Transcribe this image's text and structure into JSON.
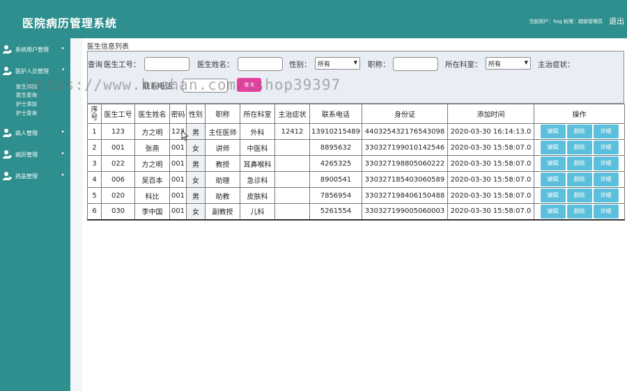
{
  "header": {
    "title": "医院病历管理系统",
    "user_info": "当前用户：hsg  权限：超级管理员",
    "logout": "退出"
  },
  "sidebar": {
    "items": [
      {
        "label": "系统用户管理",
        "icon": "user-icon"
      },
      {
        "label": "医护人员管理",
        "icon": "user-icon"
      },
      {
        "label": "病人管理",
        "icon": "user-icon"
      },
      {
        "label": "病历管理",
        "icon": "user-icon"
      },
      {
        "label": "药品管理",
        "icon": "user-icon"
      }
    ],
    "submenu": [
      "医生添加",
      "医生查询",
      "护士添加",
      "护士查询"
    ]
  },
  "panel": {
    "title": "医生信息列表"
  },
  "filter": {
    "query_label": "查询",
    "doctor_id_label": "医生工号：",
    "doctor_name_label": "医生姓名：",
    "gender_label": "性别：",
    "gender_value": "所有",
    "title_label": "职称：",
    "dept_label": "所在科室：",
    "dept_value": "所有",
    "symptom_label": "主治症状：",
    "phone_label": "联系电话：",
    "search_button": "查询"
  },
  "table": {
    "headers": [
      "序号",
      "医生工号",
      "医生姓名",
      "密码",
      "性别",
      "职称",
      "所在科室",
      "主治症状",
      "联系电话",
      "身份证",
      "添加时间",
      "操作"
    ],
    "rows": [
      [
        "1",
        "123",
        "方之明",
        "123",
        "男",
        "主任医师",
        "外科",
        "12412",
        "13910215489",
        "440325432176543098",
        "2020-03-30 16:14:13.0"
      ],
      [
        "2",
        "001",
        "张燕",
        "001",
        "女",
        "讲师",
        "中医科",
        "",
        "8895632",
        "330327199010142546",
        "2020-03-30 15:58:07.0"
      ],
      [
        "3",
        "022",
        "方之明",
        "001",
        "男",
        "教授",
        "耳鼻喉科",
        "",
        "4265325",
        "330327198805060222",
        "2020-03-30 15:58:07.0"
      ],
      [
        "4",
        "006",
        "吴百本",
        "001",
        "女",
        "助理",
        "急诊科",
        "",
        "8900541",
        "330327185403060589",
        "2020-03-30 15:58:07.0"
      ],
      [
        "5",
        "020",
        "科比",
        "001",
        "男",
        "助教",
        "皮肤科",
        "",
        "7856954",
        "330327198406150488",
        "2020-03-30 15:58:07.0"
      ],
      [
        "6",
        "030",
        "李中国",
        "001",
        "女",
        "副教授",
        "儿科",
        "",
        "5261554",
        "330327199005060003",
        "2020-03-30 15:58:07.0"
      ]
    ],
    "actions": [
      "编辑",
      "删除",
      "详细"
    ]
  },
  "watermark": "https://www.huzhan.com/ishop39397"
}
